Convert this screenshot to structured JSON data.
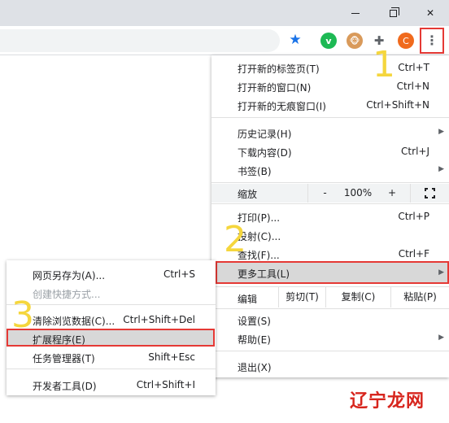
{
  "window": {
    "min_icon": "minimize-icon",
    "max_icon": "restore-icon",
    "close_icon": "close-icon",
    "close_glyph": "✕"
  },
  "toolbar": {
    "star_glyph": "★",
    "ext_green_glyph": "v",
    "ext_monkey_glyph": "🐵",
    "ext_puzzle_glyph": "✚",
    "ext_orange_glyph": "C",
    "menu_glyph": "⋮"
  },
  "main_menu": {
    "new_tab": {
      "label": "打开新的标签页(T)",
      "shortcut": "Ctrl+T"
    },
    "new_window": {
      "label": "打开新的窗口(N)",
      "shortcut": "Ctrl+N"
    },
    "incognito": {
      "label": "打开新的无痕窗口(I)",
      "shortcut": "Ctrl+Shift+N"
    },
    "history": {
      "label": "历史记录(H)",
      "arrow": "▶"
    },
    "downloads": {
      "label": "下载内容(D)",
      "shortcut": "Ctrl+J"
    },
    "bookmarks": {
      "label": "书签(B)",
      "arrow": "▶"
    },
    "zoom": {
      "label": "缩放",
      "minus": "-",
      "value": "100%",
      "plus": "+"
    },
    "print": {
      "label": "打印(P)...",
      "shortcut": "Ctrl+P"
    },
    "cast": {
      "label": "投射(C)..."
    },
    "find": {
      "label": "查找(F)...",
      "shortcut": "Ctrl+F"
    },
    "more_tools": {
      "label": "更多工具(L)",
      "arrow": "▶"
    },
    "edit": {
      "label": "编辑",
      "cut": "剪切(T)",
      "copy": "复制(C)",
      "paste": "粘贴(P)"
    },
    "settings": {
      "label": "设置(S)"
    },
    "help": {
      "label": "帮助(E)",
      "arrow": "▶"
    },
    "exit": {
      "label": "退出(X)"
    }
  },
  "sub_menu": {
    "save_as": {
      "label": "网页另存为(A)...",
      "shortcut": "Ctrl+S"
    },
    "create_shortcut": {
      "label": "创建快捷方式..."
    },
    "clear_data": {
      "label": "清除浏览数据(C)...",
      "shortcut": "Ctrl+Shift+Del"
    },
    "extensions": {
      "label": "扩展程序(E)"
    },
    "task_manager": {
      "label": "任务管理器(T)",
      "shortcut": "Shift+Esc"
    },
    "dev_tools": {
      "label": "开发者工具(D)",
      "shortcut": "Ctrl+Shift+I"
    }
  },
  "steps": {
    "one": "1",
    "two": "2",
    "three": "3"
  },
  "watermark": {
    "text": "辽宁龙网"
  },
  "colors": {
    "highlight_border": "#e53935",
    "step_color": "#f5d63d",
    "watermark": "#d7261e"
  }
}
